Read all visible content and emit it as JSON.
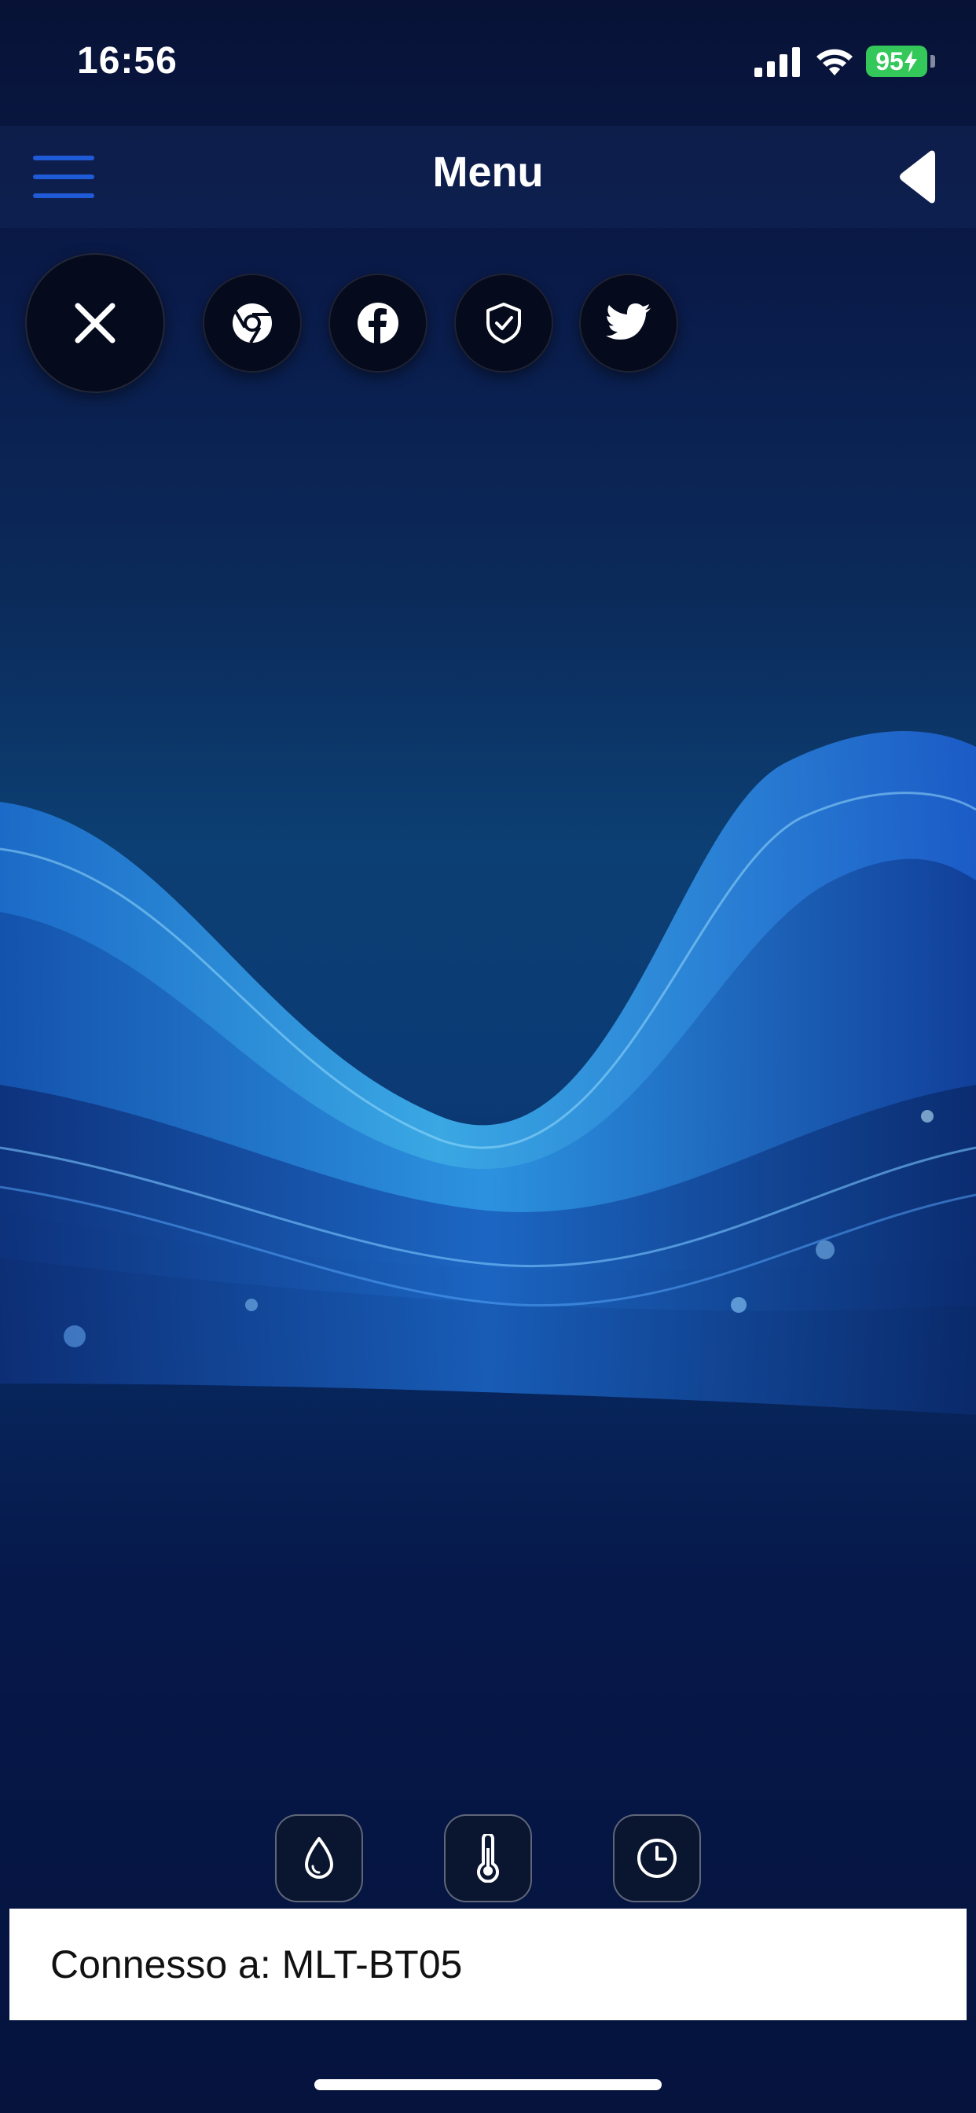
{
  "status_bar": {
    "time": "16:56",
    "battery": "95",
    "signal_icon": "cellular-signal-icon",
    "wifi_icon": "wifi-icon"
  },
  "nav": {
    "title": "Menu",
    "menu_icon": "hamburger-menu-icon",
    "back_icon": "back-triangle-icon"
  },
  "action_row": {
    "close_icon": "close-icon",
    "buttons": [
      {
        "name": "chrome",
        "icon": "chrome-icon"
      },
      {
        "name": "facebook",
        "icon": "facebook-icon"
      },
      {
        "name": "security",
        "icon": "shield-check-icon"
      },
      {
        "name": "twitter",
        "icon": "twitter-icon"
      }
    ]
  },
  "toolbar": {
    "buttons": [
      {
        "name": "humidity",
        "icon": "water-drop-icon"
      },
      {
        "name": "temperature",
        "icon": "thermometer-icon"
      },
      {
        "name": "clock",
        "icon": "clock-icon"
      }
    ]
  },
  "footer": {
    "status_text": "Connesso a: MLT-BT05"
  },
  "colors": {
    "accent_blue": "#1f5bd6",
    "battery_green": "#34c759",
    "background_dark": "#06184a"
  }
}
